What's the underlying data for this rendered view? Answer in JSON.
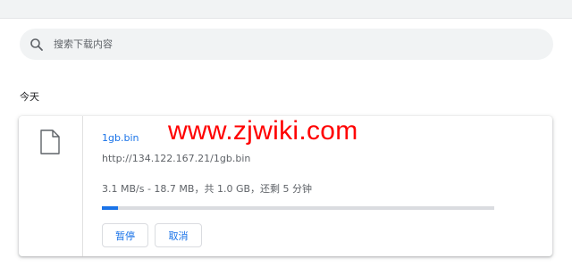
{
  "search": {
    "placeholder": "搜索下载内容",
    "value": ""
  },
  "section": {
    "date_label": "今天"
  },
  "download": {
    "file_name": "1gb.bin",
    "url": "http://134.122.167.21/1gb.bin",
    "status": "3.1 MB/s - 18.7 MB，共 1.0 GB，还剩 5 分钟",
    "progress_fraction": 0.0187,
    "pause_label": "暂停",
    "cancel_label": "取消",
    "file_icon": "file-icon"
  },
  "watermark": {
    "text": "www.zjwiki.com"
  },
  "colors": {
    "accent": "#1a73e8",
    "watermark": "#ff0000",
    "search_bg": "#f1f3f4"
  }
}
